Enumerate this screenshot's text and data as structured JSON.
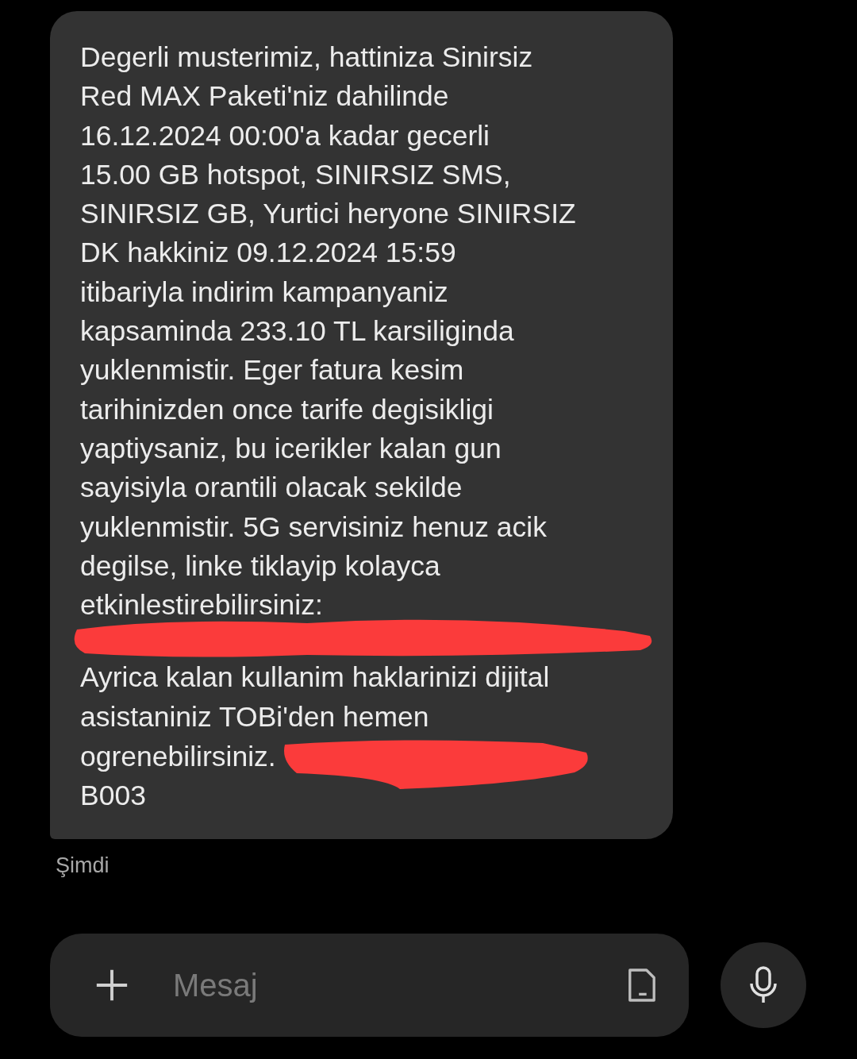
{
  "message": {
    "paragraphs": [
      "Degerli musterimiz, hattiniza Sinirsiz\nRed MAX Paketi'niz dahilinde\n16.12.2024 00:00'a kadar gecerli\n15.00 GB hotspot, SINIRSIZ SMS,\nSINIRSIZ GB, Yurtici heryone SINIRSIZ\nDK hakkiniz 09.12.2024 15:59\nitibariyla indirim kampanyaniz\nkapsaminda 233.10 TL karsiliginda\nyuklenmistir. Eger fatura kesim\ntarihinizden once tarife degisikligi\nyaptiysaniz, bu icerikler kalan gun\nsayisiyla orantili olacak sekilde\nyuklenmistir. 5G servisiniz henuz acik\ndegilse, linke tiklayip kolayca\netkinlestirebilirsiniz:",
      "Ayrica kalan kullanim haklarinizi dijital\nasistaniniz TOBi'den hemen",
      "ogrenebilirsiniz.",
      "B003"
    ],
    "time": "Şimdi"
  },
  "composer": {
    "placeholder": "Mesaj"
  }
}
